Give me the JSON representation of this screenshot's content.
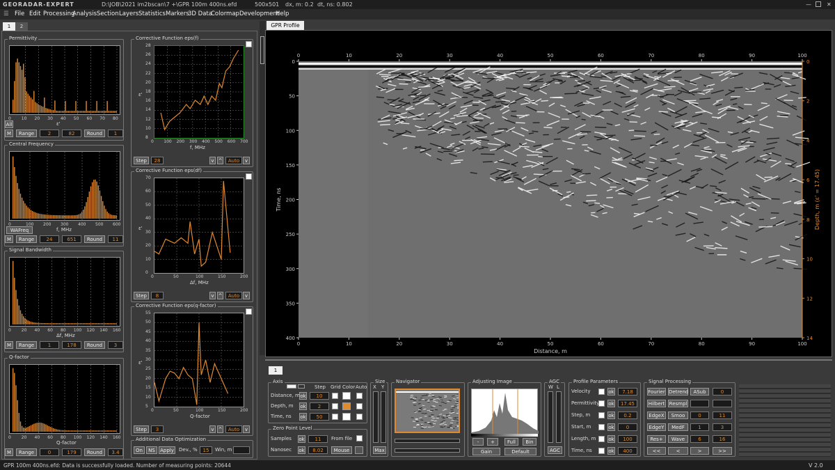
{
  "window": {
    "app": "GEORADAR-EXPERT",
    "path": "D:\\JOB\\2021  im2bscan\\7 +\\GPR 100m 400ns.efd",
    "dims": "500x501",
    "dx": "dx, m: 0.2",
    "dt": "dt, ns: 0.802"
  },
  "menu": [
    "File",
    "Edit",
    "Processing",
    "Analysis",
    "Section",
    "Layers",
    "Statistics",
    "Markers",
    "3D Data",
    "Colormap",
    "Development",
    "Help"
  ],
  "left_tabs": [
    "1",
    "2"
  ],
  "histograms": [
    {
      "title": "Permittivity",
      "xlabel": "ε'",
      "ticks": [
        "0",
        "10",
        "20",
        "30",
        "40",
        "50",
        "60",
        "70",
        "80"
      ],
      "range_label": "Range",
      "range_min": "2",
      "range_max": "82",
      "round_label": "Round",
      "round_val": "1",
      "extra": "All"
    },
    {
      "title": "Central Frequency",
      "xlabel": "f, MHz",
      "ticks": [
        "0",
        "100",
        "200",
        "300",
        "400",
        "500",
        "600"
      ],
      "range_label": "Range",
      "range_min": "24",
      "range_max": "651",
      "round_label": "Round",
      "round_val": "11",
      "extra": "WAFreq"
    },
    {
      "title": "Signal Bandwidth",
      "xlabel": "Δf, MHz",
      "ticks": [
        "0",
        "20",
        "40",
        "60",
        "80",
        "100",
        "120",
        "140",
        "160"
      ],
      "range_label": "Range",
      "range_min": "1",
      "range_max": "178",
      "round_label": "Round",
      "round_val": "3",
      "extra": ""
    },
    {
      "title": "Q-factor",
      "xlabel": "Q-factor",
      "ticks": [
        "0",
        "20",
        "40",
        "60",
        "80",
        "100",
        "120",
        "140",
        "160"
      ],
      "range_label": "Range",
      "range_min": "0",
      "range_max": "179",
      "round_label": "Round",
      "round_val": "3.4",
      "extra": ""
    }
  ],
  "m_label": "M",
  "corr": [
    {
      "title": "Corrective Function eps(f)",
      "ylabel": "ε'",
      "xlabel": "f, MHz",
      "xticks": [
        "0",
        "100",
        "200",
        "300",
        "400",
        "500",
        "600",
        "700"
      ],
      "yticks": [
        "8",
        "10",
        "12",
        "14",
        "16",
        "18",
        "20",
        "22",
        "24",
        "26",
        "28"
      ],
      "step_label": "Step",
      "step": "28",
      "auto": "Auto"
    },
    {
      "title": "Corrective Function eps(df)",
      "ylabel": "ε'",
      "xlabel": "Δf, MHz",
      "xticks": [
        "0",
        "50",
        "100",
        "150",
        "200"
      ],
      "yticks": [
        "0",
        "10",
        "20",
        "30",
        "40",
        "50",
        "60",
        "70"
      ],
      "step_label": "Step",
      "step": "8",
      "auto": "Auto"
    },
    {
      "title": "Corrective Function eps(q-factor)",
      "ylabel": "ε'",
      "xlabel": "Q-factor",
      "xticks": [
        "0",
        "50",
        "100",
        "150",
        "200"
      ],
      "yticks": [
        "5",
        "10",
        "15",
        "20",
        "25",
        "30",
        "35",
        "40",
        "45",
        "50",
        "55"
      ],
      "step_label": "Step",
      "step": "3",
      "auto": "Auto"
    }
  ],
  "ado": {
    "title": "Additional Data Optimization",
    "on": "On",
    "ns": "NS",
    "apply": "Apply",
    "dev_label": "Dev., %",
    "dev": "15",
    "win_label": "Win, m"
  },
  "gpr": {
    "tab": "GPR Profile",
    "xlabel": "Distance, m",
    "ylabel": "Time, ns",
    "y2label": "Depth, m (ε' = 17.45)",
    "xticks": [
      "0",
      "10",
      "20",
      "30",
      "40",
      "50",
      "60",
      "70",
      "80",
      "90",
      "100"
    ],
    "yticks": [
      "0",
      "50",
      "100",
      "150",
      "200",
      "250",
      "300",
      "350",
      "400"
    ],
    "dticks": [
      "0",
      "2",
      "4",
      "6",
      "8",
      "10",
      "12",
      "14"
    ]
  },
  "bottom_tab": "1",
  "axis": {
    "title": "Axis",
    "hdr_step": "Step",
    "hdr_grid": "Grid",
    "hdr_color": "Color",
    "hdr_auto": "Auto",
    "rows": [
      {
        "label": "Distance, m",
        "val": "10"
      },
      {
        "label": "Depth, m",
        "val": "2"
      },
      {
        "label": "Time, ns",
        "val": "50"
      }
    ],
    "ok": "ok"
  },
  "zpl": {
    "title": "Zero Point Level",
    "samples_label": "Samples",
    "samples": "11",
    "from_file": "From file",
    "nanosec_label": "Nanosec",
    "nanosec": "8.02",
    "mouse": "Mouse"
  },
  "size": {
    "title": "Size",
    "x": "X",
    "y": "Y",
    "max": "Max"
  },
  "navigator": {
    "title": "Navigator"
  },
  "adjust": {
    "title": "Adjusting Image",
    "minus": "-",
    "plus": "+",
    "full": "Full",
    "bin": "Bin",
    "gain": "Gain",
    "default": "Default"
  },
  "agc": {
    "title": "AGC",
    "w": "W",
    "l": "L",
    "btn": "AGC"
  },
  "params": {
    "title": "Profile Parameters",
    "rows": [
      {
        "label": "Velocity",
        "val": "7.18"
      },
      {
        "label": "Permittivity",
        "val": "17.45"
      },
      {
        "label": "Step, m",
        "val": "0.2"
      },
      {
        "label": "Start, m",
        "val": "0"
      },
      {
        "label": "Length, m",
        "val": "100"
      },
      {
        "label": "Time, ns",
        "val": "400"
      }
    ]
  },
  "signal": {
    "title": "Signal Processing",
    "r1": [
      "Fourier",
      "Detrend",
      "ASub",
      "0"
    ],
    "r2": [
      "Hilbert",
      "Resmpl"
    ],
    "r3": [
      "EdgeX",
      "Smoo",
      "0",
      "11"
    ],
    "r4": [
      "EdgeY",
      "MedF",
      "1",
      "3"
    ],
    "r5": [
      "Res+",
      "Wave",
      "6",
      "16"
    ],
    "nav": [
      "<<",
      "<",
      ">",
      ">>"
    ]
  },
  "status": {
    "text": "GPR 100m 400ns.efd:   Data is successfully loaded. Number of measuring points: 20644",
    "version": "V 2.0"
  },
  "colors": {
    "accent": "#e08a30",
    "bg": "#3a3a3a"
  }
}
